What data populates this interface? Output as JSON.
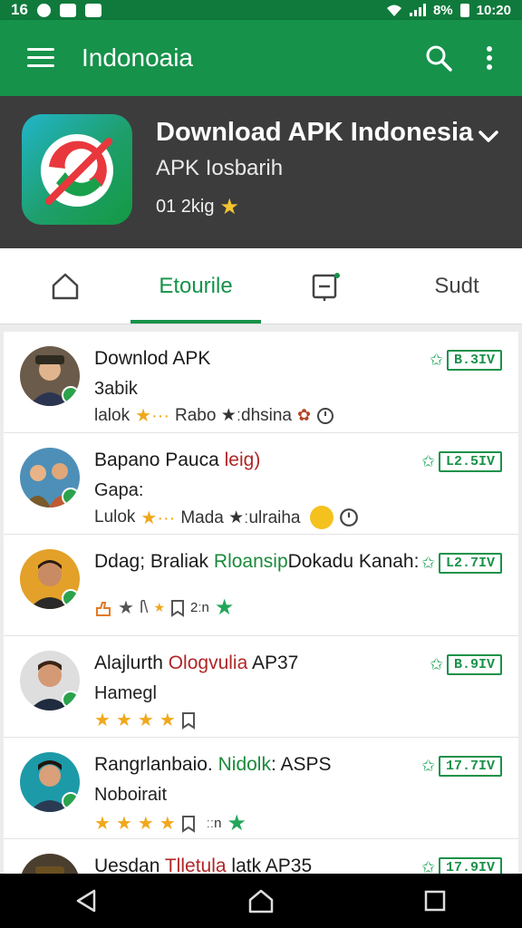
{
  "status_bar": {
    "left_text": "16",
    "right_text": "8%",
    "time": "10:20"
  },
  "app_bar": {
    "title": "Indonoaia",
    "icons": [
      "menu-icon",
      "search-icon",
      "more-vert-icon"
    ]
  },
  "hero": {
    "app_name": "Download APK Indonesia",
    "developer": "APK Iosbarih",
    "meta_text": "01 2kig",
    "meta_icon": "star-icon"
  },
  "tabs": [
    {
      "label": "",
      "icon": "home-icon"
    },
    {
      "label": "Etourile",
      "active": true
    },
    {
      "label": "",
      "icon": "tag-icon"
    },
    {
      "label": "Sudt"
    }
  ],
  "list": [
    {
      "title": "Downlod APK",
      "subtitle": "3abik",
      "meta": [
        "lalok",
        "★···",
        "Rabo ★ːdhsina"
      ],
      "badge": "B.3IV"
    },
    {
      "title_main": "Bapano Pauca",
      "title_red": "leig)",
      "subtitle": "Gapa:",
      "meta": [
        "Lulok",
        "★···",
        "Mada ★ːulraiha"
      ],
      "badge": "L2.5IV"
    },
    {
      "title_main": "Ddag; Braliak",
      "title_green": "Rloansip",
      "title_tail": "Dokadu Kanah:",
      "subtitle": "",
      "meta": [
        "2ːn"
      ],
      "badge": "L2.7IV"
    },
    {
      "title_main": "Alajlurth",
      "title_red": "Ologvulia",
      "title_tail": "AP37",
      "subtitle": "Hamegl",
      "meta": [],
      "badge": "B.9IV"
    },
    {
      "title_main": "Rangrlanbaio.",
      "title_green": "Nidolk",
      "title_tail": "ASPS",
      "subtitle": "Noboirait",
      "meta": [
        "ːːn"
      ],
      "badge": "17.7IV"
    },
    {
      "title_main": "Uesdan",
      "title_red": "Tlletula",
      "title_tail": "latk AP35",
      "subtitle": "",
      "meta": [],
      "badge": "17.9IV"
    }
  ],
  "colors": {
    "primary": "#16924a",
    "status_bar": "#0f7a3c",
    "hero_bg": "#3c3c3c",
    "star": "#f0a81c"
  }
}
